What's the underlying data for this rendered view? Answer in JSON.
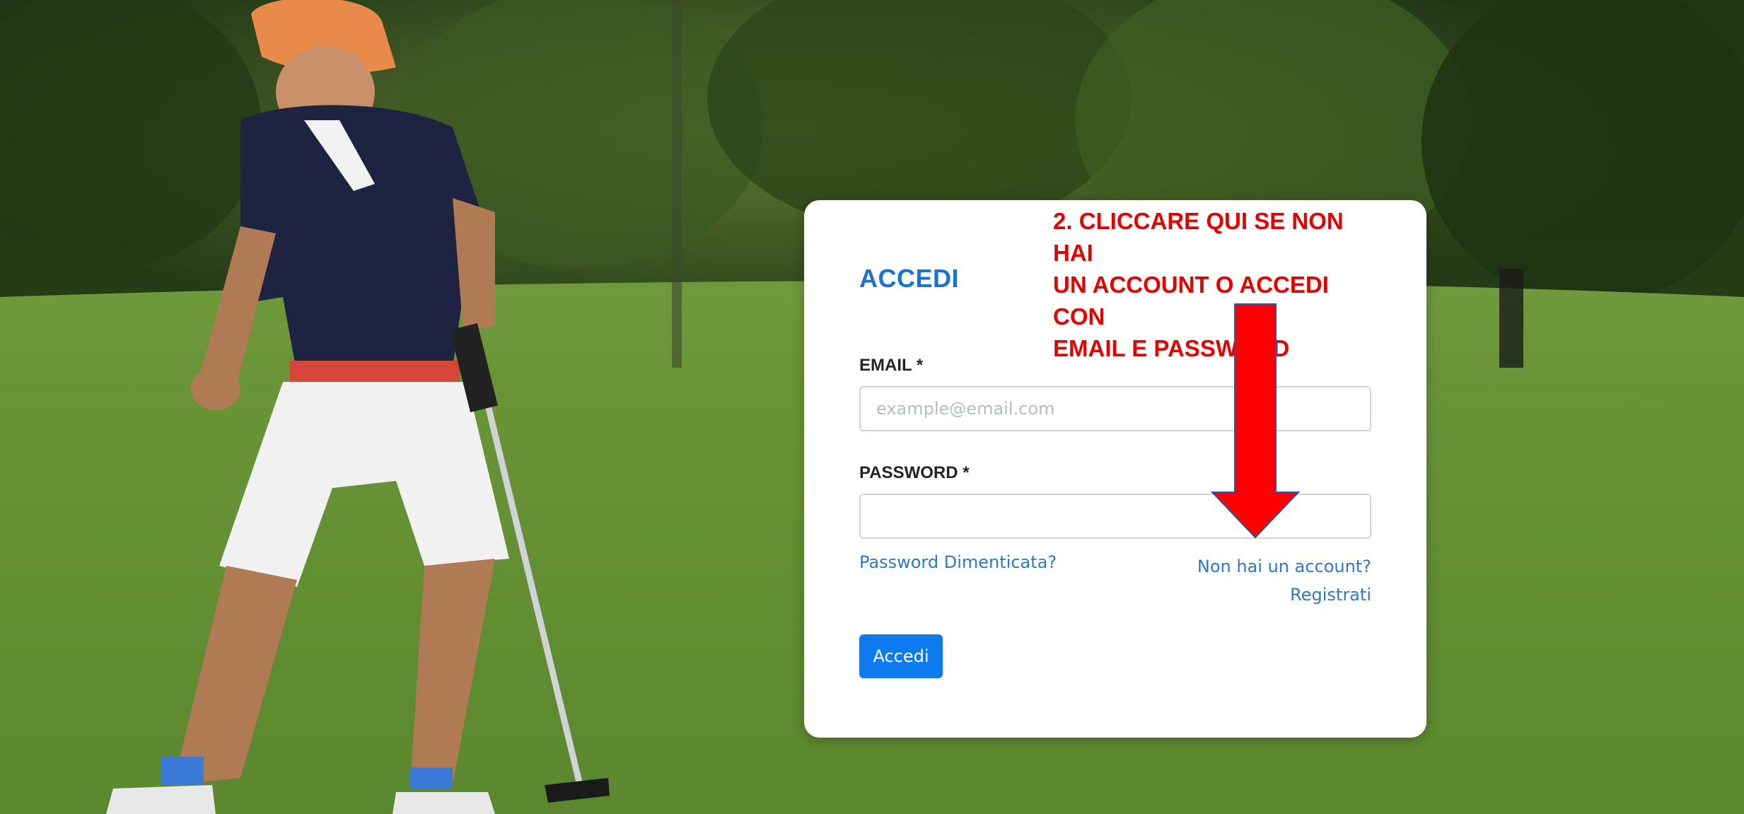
{
  "login": {
    "title": "ACCEDI",
    "email_label": "EMAIL *",
    "email_placeholder": "example@email.com",
    "email_value": "",
    "password_label": "PASSWORD *",
    "password_value": "",
    "forgot_password_link": "Password Dimenticata?",
    "no_account_text": "Non hai un account?",
    "register_link": "Registrati",
    "submit_label": "Accedi"
  },
  "annotation": {
    "lines": [
      "2. CLICCARE QUI SE NON HAI",
      "UN ACCOUNT O ACCEDI CON",
      "EMAIL E PASSWORD"
    ],
    "color": "#e60000"
  },
  "colors": {
    "title": "#1a73d1",
    "link": "#2f78c5",
    "button": "#0d7af0"
  },
  "background": {
    "description_icon": "golf-course-photo"
  }
}
